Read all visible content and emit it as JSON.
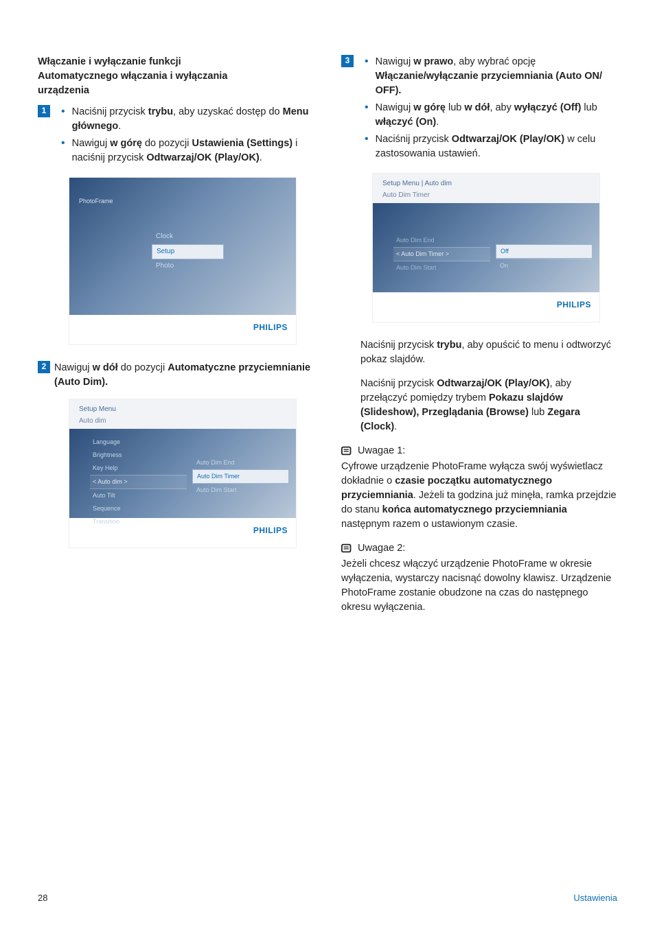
{
  "left": {
    "heading_l1": "Włączanie i wyłączanie funkcji",
    "heading_l2": "Automatycznego włączania i wyłączania",
    "heading_l3": "urządzenia",
    "step1": {
      "num": "1",
      "b1_pre": "Naciśnij przycisk ",
      "b1_bold1": "trybu",
      "b1_mid": ", aby uzyskać dostęp do ",
      "b1_bold2": "Menu głównego",
      "b1_end": ".",
      "b2_pre": "Nawiguj ",
      "b2_bold1": "w górę",
      "b2_mid1": " do pozycji ",
      "b2_bold2": "Ustawienia (Settings)",
      "b2_mid2": " i naciśnij przycisk ",
      "b2_bold3": "Odtwarzaj/OK (Play/OK)",
      "b2_end": "."
    },
    "shot1": {
      "pf": "PhotoFrame",
      "items": [
        "Clock",
        "Setup",
        "Photo"
      ],
      "brand": "PHILIPS"
    },
    "step2": {
      "num": "2",
      "pre": "Nawiguj ",
      "bold1": "w dół",
      "mid": " do pozycji ",
      "bold2": "Automatyczne przyciemnianie (Auto Dim).",
      "end": ""
    },
    "shot2": {
      "crumb": "Setup Menu",
      "sub": "Auto dim",
      "left_items": [
        "Language",
        "Brightness",
        "Key Help",
        "< Auto dim >",
        "Auto Tilt",
        "Sequence",
        "Transition"
      ],
      "right_items": [
        "Auto Dim End",
        "Auto Dim Timer",
        "Auto Dim Start"
      ],
      "brand": "PHILIPS"
    }
  },
  "right": {
    "step3": {
      "num": "3",
      "b1_pre": "Nawiguj ",
      "b1_bold1": "w prawo",
      "b1_mid": ", aby wybrać opcję ",
      "b1_bold2": "Włączanie/wyłączanie przyciemniania (Auto ON/ OFF).",
      "b2_pre": "Nawiguj ",
      "b2_bold1": "w górę",
      "b2_mid1": " lub ",
      "b2_bold2": "w dół",
      "b2_mid2": ", aby ",
      "b2_bold3": "wyłączyć (Off)",
      "b2_mid3": " lub ",
      "b2_bold4": "włączyć (On)",
      "b2_end": ".",
      "b3_pre": "Naciśnij przycisk ",
      "b3_bold1": "Odtwarzaj/OK (Play/OK)",
      "b3_end": " w celu zastosowania ustawień."
    },
    "shot3": {
      "crumb": "Setup Menu | Auto dim",
      "sub": "Auto Dim Timer",
      "left_items": [
        "Auto Dim End",
        "< Auto Dim Timer >",
        "Auto Dim Start"
      ],
      "right_items": [
        "Off",
        "On"
      ],
      "brand": "PHILIPS"
    },
    "p1_pre": "Naciśnij przycisk ",
    "p1_bold": "trybu",
    "p1_end": ", aby opuścić to menu i odtworzyć pokaz slajdów.",
    "p2_pre": "Naciśnij przycisk ",
    "p2_bold1": "Odtwarzaj/OK (Play/OK)",
    "p2_mid1": ", aby przełączyć pomiędzy trybem ",
    "p2_bold2": "Pokazu slajdów (Slideshow), Przeglądania (Browse)",
    "p2_mid2": " lub ",
    "p2_bold3": "Zegara (Clock)",
    "p2_end": ".",
    "note1_label": "Uwagae 1:",
    "note1_pre": "Cyfrowe urządzenie PhotoFrame wyłącza swój wyświetlacz dokładnie o ",
    "note1_bold1": "czasie początku automatycznego przyciemniania",
    "note1_mid": ". Jeżeli ta godzina już minęła, ramka przejdzie do stanu ",
    "note1_bold2": "końca automatycznego przyciemniania",
    "note1_end": " następnym razem o ustawionym czasie.",
    "note2_label": "Uwagae 2:",
    "note2_body": "Jeżeli chcesz włączyć urządzenie PhotoFrame w okresie wyłączenia, wystarczy nacisnąć dowolny klawisz. Urządzenie PhotoFrame zostanie obudzone na czas do następnego okresu wyłączenia."
  },
  "footer": {
    "page": "28",
    "section": "Ustawienia"
  }
}
